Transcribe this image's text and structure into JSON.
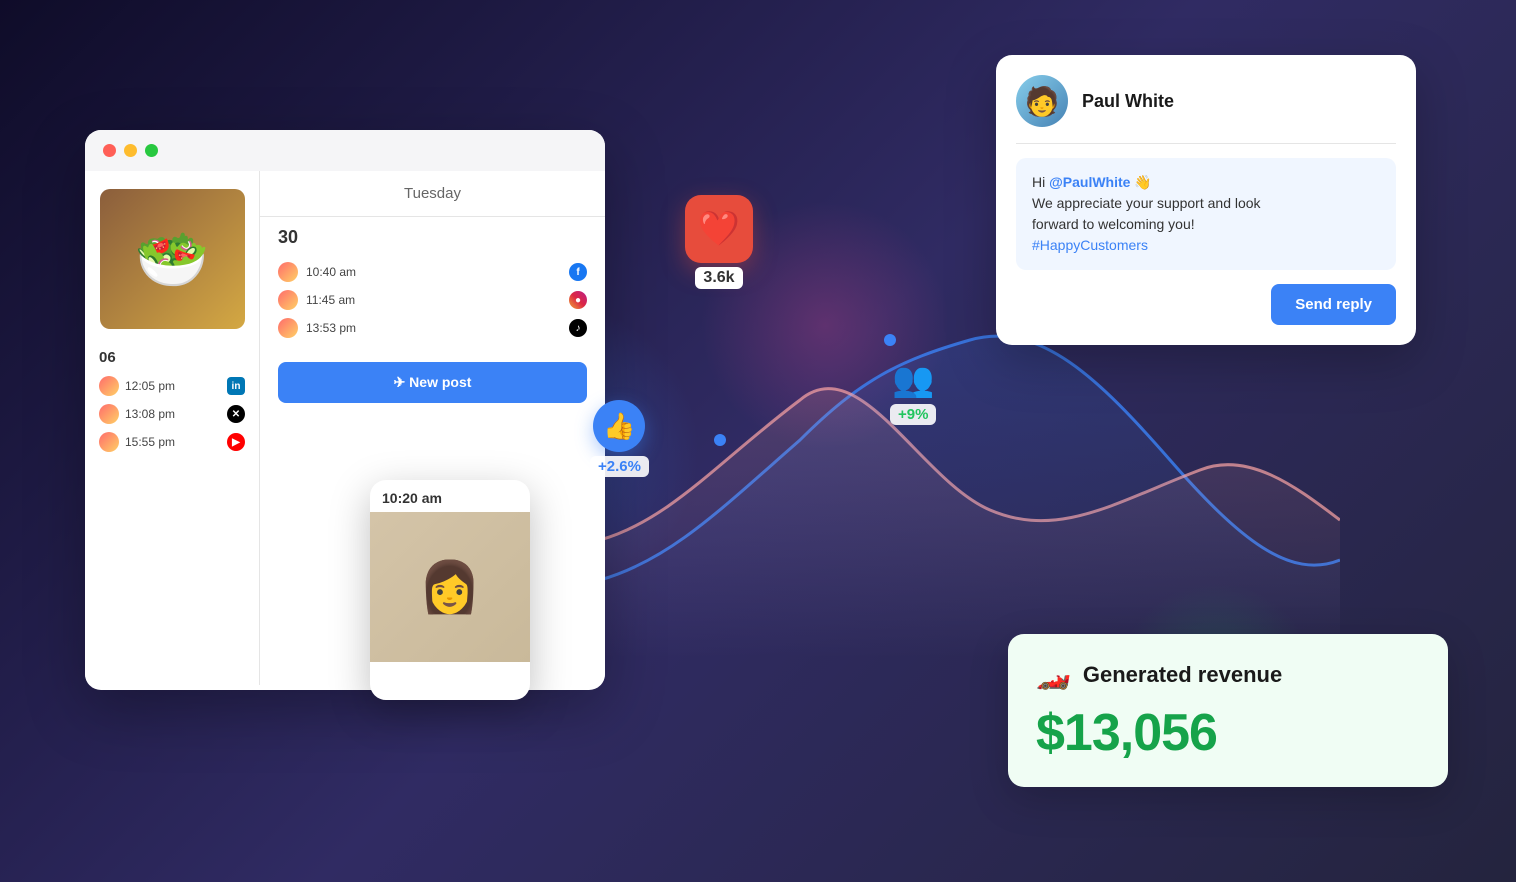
{
  "scene": {
    "background": "#1a1a2e"
  },
  "calendar_card": {
    "window_controls": {
      "close": "●",
      "minimize": "●",
      "maximize": "●"
    },
    "day_header": "Tuesday",
    "day_30": {
      "number": "30",
      "events": [
        {
          "time": "10:40 am",
          "platform": "facebook",
          "icon": "f"
        },
        {
          "time": "11:45 am",
          "platform": "instagram",
          "icon": "ig"
        },
        {
          "time": "13:53 pm",
          "platform": "tiktok",
          "icon": "tt"
        }
      ]
    },
    "day_06": {
      "number": "06",
      "events": [
        {
          "time": "12:05 pm",
          "platform": "linkedin",
          "icon": "in"
        },
        {
          "time": "13:08 pm",
          "platform": "x",
          "icon": "x"
        },
        {
          "time": "15:55 pm",
          "platform": "youtube",
          "icon": "yt"
        }
      ]
    },
    "new_post_button": "✈ New post"
  },
  "post_preview": {
    "time": "10:20 am"
  },
  "chart": {
    "heart_value": "3.6k",
    "thumbs_pct": "+2.6%",
    "users_pct": "+9%"
  },
  "reply_card": {
    "user_name": "Paul White",
    "message_line1": "Hi ",
    "mention": "@PaulWhite",
    "wave": " 👋",
    "message_line2": "We appreciate your support and look",
    "message_line3": "forward to welcoming you!",
    "hashtag": "#HappyCustomers",
    "send_button": "Send reply"
  },
  "revenue_card": {
    "label": "Generated revenue",
    "value": "$13,056"
  }
}
